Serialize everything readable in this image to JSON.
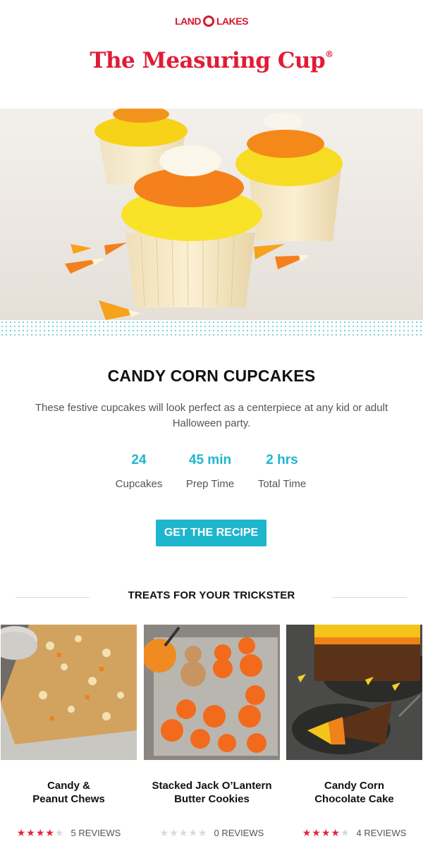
{
  "header": {
    "logo_left": "LAND",
    "logo_right": "LAKES",
    "title": "The Measuring Cup",
    "registered": "®"
  },
  "hero": {
    "icon": "cupcake-photo"
  },
  "recipe": {
    "title": "CANDY CORN CUPCAKES",
    "description": "These festive cupcakes will look perfect as a centerpiece at any kid or adult Halloween party.",
    "stats": [
      {
        "value": "24",
        "label": "Cupcakes"
      },
      {
        "value": "45 min",
        "label": "Prep Time"
      },
      {
        "value": "2 hrs",
        "label": "Total Time"
      }
    ],
    "cta_label": "GET THE RECIPE"
  },
  "related": {
    "heading": "TREATS FOR YOUR TRICKSTER",
    "items": [
      {
        "name_line1": "Candy &",
        "name_line2": "Peanut Chews",
        "rating": 4,
        "reviews": "5 REVIEWS"
      },
      {
        "name_line1": "Stacked Jack O’Lantern",
        "name_line2": "Butter Cookies",
        "rating": 0,
        "reviews": "0 REVIEWS"
      },
      {
        "name_line1": "Candy Corn",
        "name_line2": "Chocolate Cake",
        "rating": 4,
        "reviews": "4 REVIEWS"
      }
    ]
  },
  "colors": {
    "brand_red": "#e11b36",
    "accent_teal": "#1eb6cc",
    "star_red": "#e0263d"
  }
}
